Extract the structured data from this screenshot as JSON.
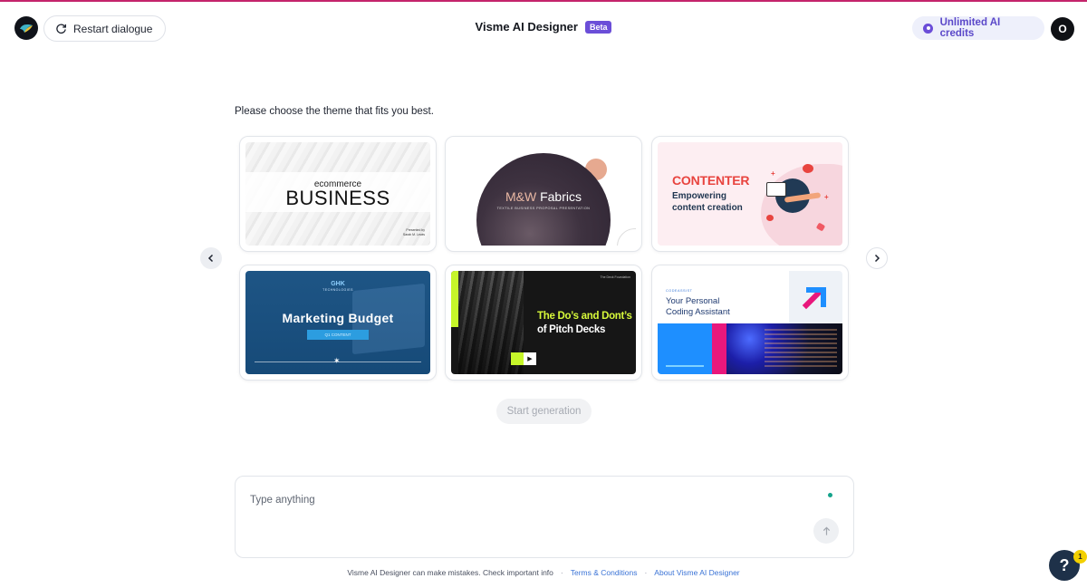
{
  "header": {
    "restart_label": "Restart dialogue",
    "app_name": "Visme AI Designer",
    "badge": "Beta",
    "credits_label": "Unlimited AI credits",
    "avatar_initial": "O"
  },
  "main": {
    "prompt": "Please choose the theme that fits you best.",
    "start_label": "Start generation"
  },
  "themes": [
    {
      "small": "ecommerce",
      "big": "BUSINESS",
      "pres": "Presented by",
      "presenter": "Sarah M. Lewis"
    },
    {
      "title_a": "M&W",
      "title_b": " Fabrics",
      "sub": "TEXTILE BUSINESS PROPOSAL PRESENTATION"
    },
    {
      "head": "CONTENTER",
      "sub1": "Empowering",
      "sub2": "content creation"
    },
    {
      "brand": "GHK",
      "brand2": "TECHNOLOGIES",
      "head": "Marketing Budget",
      "pill": "Q1 CONTENT"
    },
    {
      "h1": "The Do’s and Dont’s",
      "h2": "of Pitch Decks",
      "tag": "The Deck Foundation"
    },
    {
      "label": "CODEASSIST",
      "h1": "Your Personal",
      "h2": "Coding Assistant"
    }
  ],
  "chat": {
    "placeholder": "Type anything"
  },
  "footer": {
    "disclaimer": "Visme AI Designer can make mistakes. Check important info",
    "terms": "Terms & Conditions",
    "about": "About Visme AI Designer"
  },
  "help": {
    "label": "?",
    "badge": "1"
  }
}
